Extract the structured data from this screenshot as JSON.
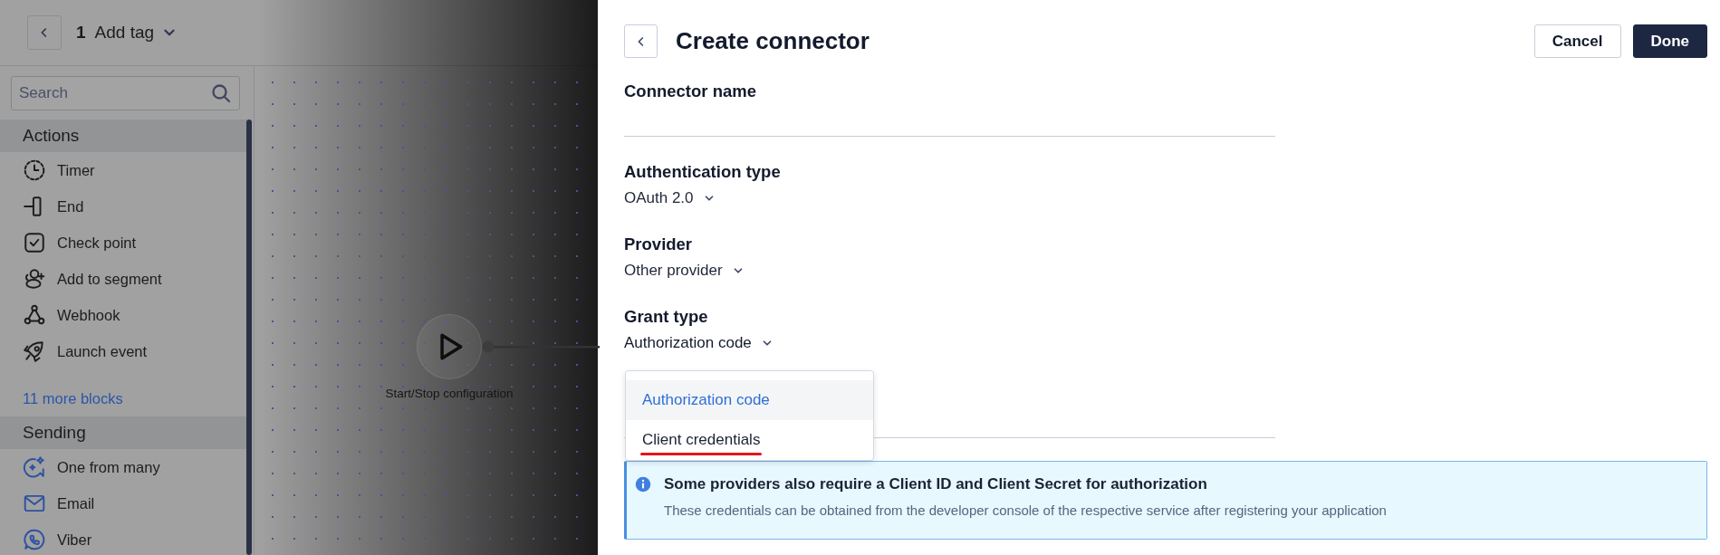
{
  "toolbar": {
    "step": "1",
    "title": "Add tag"
  },
  "sidebar": {
    "search": {
      "placeholder": "Search"
    },
    "sections": [
      {
        "title": "Actions",
        "items": [
          {
            "label": "Timer"
          },
          {
            "label": "End"
          },
          {
            "label": "Check point"
          },
          {
            "label": "Add to segment"
          },
          {
            "label": "Webhook"
          },
          {
            "label": "Launch event"
          }
        ],
        "more_link": "11 more blocks"
      },
      {
        "title": "Sending",
        "items": [
          {
            "label": "One from many"
          },
          {
            "label": "Email"
          },
          {
            "label": "Viber"
          }
        ]
      }
    ]
  },
  "canvas": {
    "nodes": [
      {
        "label": "Start/Stop configuration"
      }
    ]
  },
  "panel": {
    "title": "Create connector",
    "buttons": [
      {
        "label": "Cancel",
        "kind": "secondary"
      },
      {
        "label": "Done",
        "kind": "primary"
      }
    ],
    "fields": [
      {
        "label": "Connector name",
        "kind": "input"
      },
      {
        "label": "Authentication type",
        "kind": "select",
        "value": "OAuth 2.0",
        "expanded": false
      },
      {
        "label": "Provider",
        "kind": "select",
        "value": "Other provider",
        "expanded": false
      },
      {
        "label": "Grant type",
        "kind": "select",
        "value": "Authorization code",
        "expanded": true,
        "options": [
          {
            "label": "Authorization code",
            "selected": true,
            "underlined": false
          },
          {
            "label": "Client credentials",
            "selected": false,
            "underlined": true
          }
        ]
      }
    ],
    "notice": {
      "title": "Some providers also require a Client ID and Client Secret for authorization",
      "text": "These credentials can be obtained from the developer console of the respective service after registering your application"
    }
  }
}
